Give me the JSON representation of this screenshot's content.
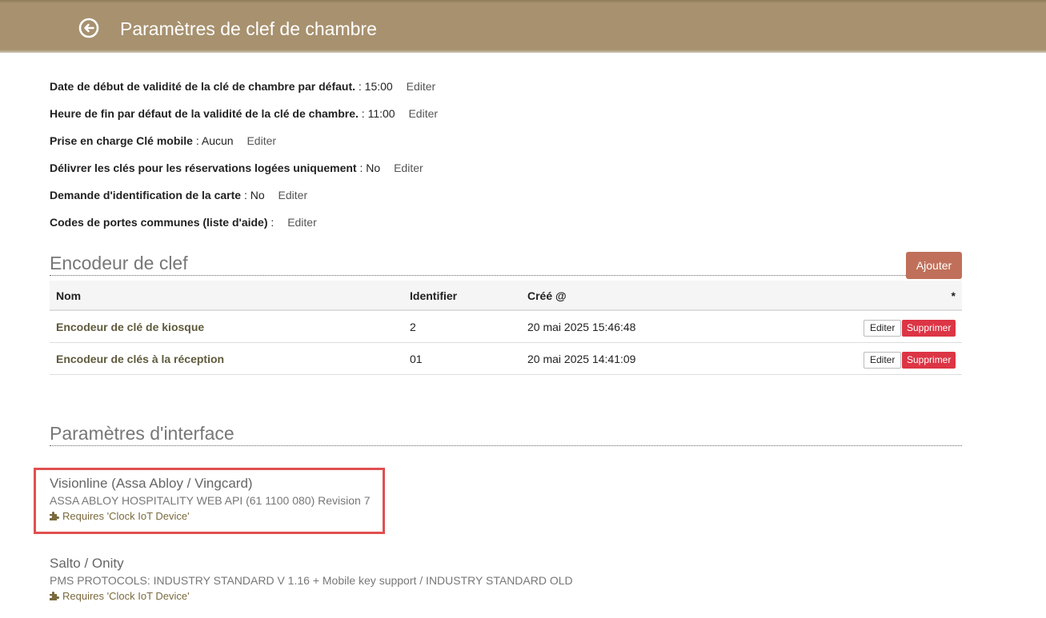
{
  "header": {
    "title": "Paramètres de clef de chambre",
    "back_icon": "arrow-left-circle-icon"
  },
  "settings": [
    {
      "label": "Date de début de validité de la clé de chambre par défaut.",
      "value": "15:00",
      "edit": "Editer"
    },
    {
      "label": "Heure de fin par défaut de la validité de la clé de chambre.",
      "value": "11:00",
      "edit": "Editer"
    },
    {
      "label": "Prise en charge Clé mobile",
      "value": "Aucun",
      "edit": "Editer"
    },
    {
      "label": "Délivrer les clés pour les réservations logées uniquement",
      "value": "No",
      "edit": "Editer"
    },
    {
      "label": "Demande d'identification de la carte",
      "value": "No",
      "edit": "Editer"
    },
    {
      "label": "Codes de portes communes (liste d'aide)",
      "value": "",
      "edit": "Editer"
    }
  ],
  "encoders": {
    "title": "Encodeur de clef",
    "add_label": "Ajouter",
    "columns": [
      "Nom",
      "Identifier",
      "Créé @",
      "*"
    ],
    "rows": [
      {
        "name": "Encodeur de clé de kiosque",
        "id": "2",
        "created": "20 mai 2025 15:46:48",
        "edit": "Editer",
        "delete": "Supprimer"
      },
      {
        "name": "Encodeur de clés à la réception",
        "id": "01",
        "created": "20 mai 2025 14:41:09",
        "edit": "Editer",
        "delete": "Supprimer"
      }
    ]
  },
  "interfaces": {
    "title": "Paramètres d'interface",
    "items": [
      {
        "name": "Visionline (Assa Abloy / Vingcard)",
        "desc": "ASSA ABLOY HOSPITALITY WEB API (61 1100 080) Revision 7",
        "requires": "Requires 'Clock IoT Device'"
      },
      {
        "name": "Salto / Onity",
        "desc": "PMS PROTOCOLS: INDUSTRY STANDARD V 1.16 + Mobile key support / INDUSTRY STANDARD OLD",
        "requires": "Requires 'Clock IoT Device'"
      }
    ]
  },
  "colors": {
    "header_bg": "#a7916f",
    "add_button": "#c0705a",
    "delete_button": "#dc3545",
    "highlight": "#e05050",
    "encoder_name": "#5f5a3c"
  }
}
